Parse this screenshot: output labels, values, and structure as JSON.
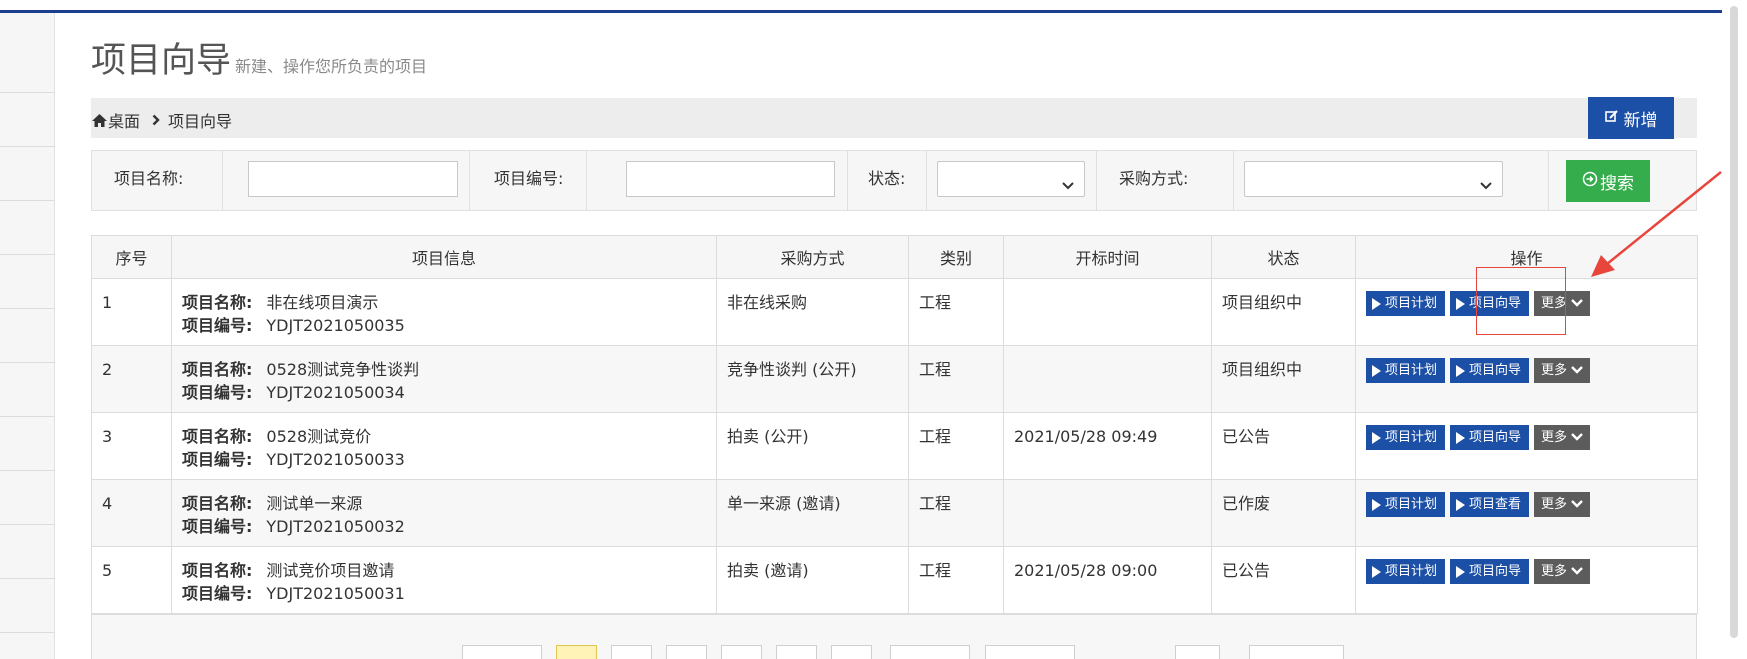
{
  "page": {
    "title": "项目向导",
    "subtitle": "新建、操作您所负责的项目"
  },
  "breadcrumb": {
    "home": "桌面",
    "current": "项目向导"
  },
  "toolbar": {
    "add_label": "新增"
  },
  "search": {
    "name_label": "项目名称:",
    "code_label": "项目编号:",
    "status_label": "状态:",
    "method_label": "采购方式:",
    "name_value": "",
    "code_value": "",
    "status_value": "",
    "method_value": "",
    "button_label": "搜索"
  },
  "table": {
    "headers": [
      "序号",
      "项目信息",
      "采购方式",
      "类别",
      "开标时间",
      "状态",
      "操作"
    ],
    "info_keys": {
      "name": "项目名称:",
      "code": "项目编号:"
    },
    "rows": [
      {
        "index": "1",
        "name": "非在线项目演示",
        "code": "YDJT2021050035",
        "method": "非在线采购",
        "category": "工程",
        "open_time": "",
        "status": "项目组织中",
        "op1": "项目计划",
        "op2": "项目向导",
        "op3": "更多"
      },
      {
        "index": "2",
        "name": "0528测试竞争性谈判",
        "code": "YDJT2021050034",
        "method": "竞争性谈判 (公开)",
        "category": "工程",
        "open_time": "",
        "status": "项目组织中",
        "op1": "项目计划",
        "op2": "项目向导",
        "op3": "更多"
      },
      {
        "index": "3",
        "name": "0528测试竞价",
        "code": "YDJT2021050033",
        "method": "拍卖 (公开)",
        "category": "工程",
        "open_time": "2021/05/28 09:49",
        "status": "已公告",
        "op1": "项目计划",
        "op2": "项目向导",
        "op3": "更多"
      },
      {
        "index": "4",
        "name": "测试单一来源",
        "code": "YDJT2021050032",
        "method": "单一来源 (邀请)",
        "category": "工程",
        "open_time": "",
        "status": "已作废",
        "op1": "项目计划",
        "op2": "项目查看",
        "op3": "更多"
      },
      {
        "index": "5",
        "name": "测试竞价项目邀请",
        "code": "YDJT2021050031",
        "method": "拍卖 (邀请)",
        "category": "工程",
        "open_time": "2021/05/28 09:00",
        "status": "已公告",
        "op1": "项目计划",
        "op2": "项目向导",
        "op3": "更多"
      }
    ]
  },
  "colors": {
    "primary": "#1c4fa6",
    "success": "#35ad4c",
    "more": "#5c5c5c",
    "annotation": "#e8453c",
    "top_line": "#1b3f8e"
  },
  "icons": {
    "home": "home-icon",
    "breadcrumb_separator": "chevron-right-icon",
    "add": "edit-icon",
    "search": "arrow-circle-icon",
    "select": "chevron-down-icon",
    "op": "play-icon"
  }
}
